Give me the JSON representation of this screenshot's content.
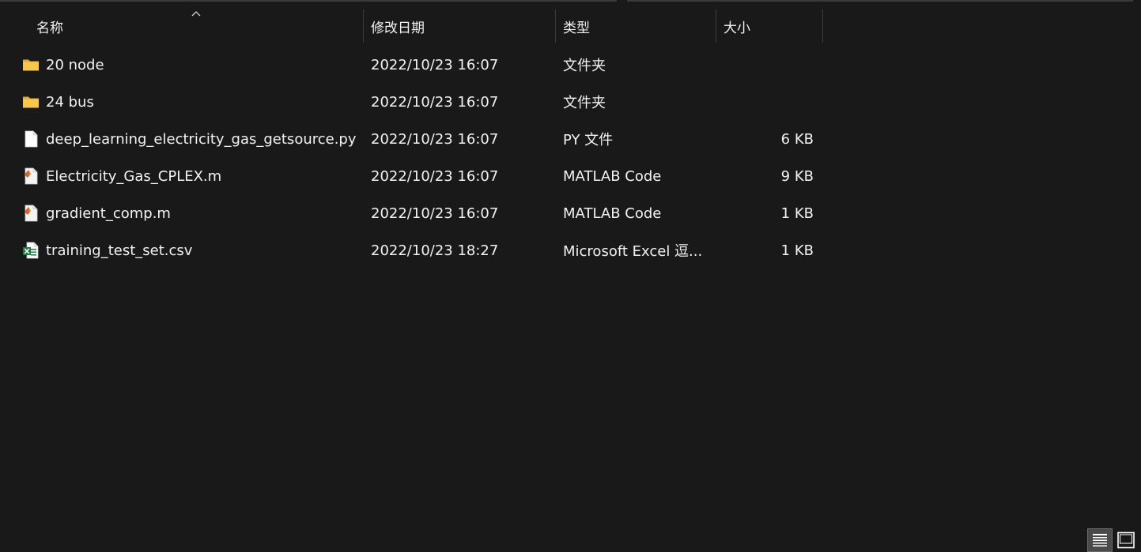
{
  "columns": {
    "name": "名称",
    "date": "修改日期",
    "type": "类型",
    "size": "大小"
  },
  "files": [
    {
      "name": "20 node",
      "date": "2022/10/23 16:07",
      "type": "文件夹",
      "size": "",
      "icon": "folder-icon"
    },
    {
      "name": "24 bus",
      "date": "2022/10/23 16:07",
      "type": "文件夹",
      "size": "",
      "icon": "folder-icon"
    },
    {
      "name": "deep_learning_electricity_gas_getsource.py",
      "date": "2022/10/23 16:07",
      "type": "PY 文件",
      "size": "6 KB",
      "icon": "python-file-icon"
    },
    {
      "name": "Electricity_Gas_CPLEX.m",
      "date": "2022/10/23 16:07",
      "type": "MATLAB Code",
      "size": "9 KB",
      "icon": "matlab-file-icon"
    },
    {
      "name": "gradient_comp.m",
      "date": "2022/10/23 16:07",
      "type": "MATLAB Code",
      "size": "1 KB",
      "icon": "matlab-file-icon"
    },
    {
      "name": "training_test_set.csv",
      "date": "2022/10/23 18:27",
      "type": "Microsoft Excel 逗...",
      "size": "1 KB",
      "icon": "excel-csv-icon"
    }
  ],
  "colors": {
    "background": "#191919",
    "text": "#f2f2f2",
    "folder": "#f8c64a"
  }
}
